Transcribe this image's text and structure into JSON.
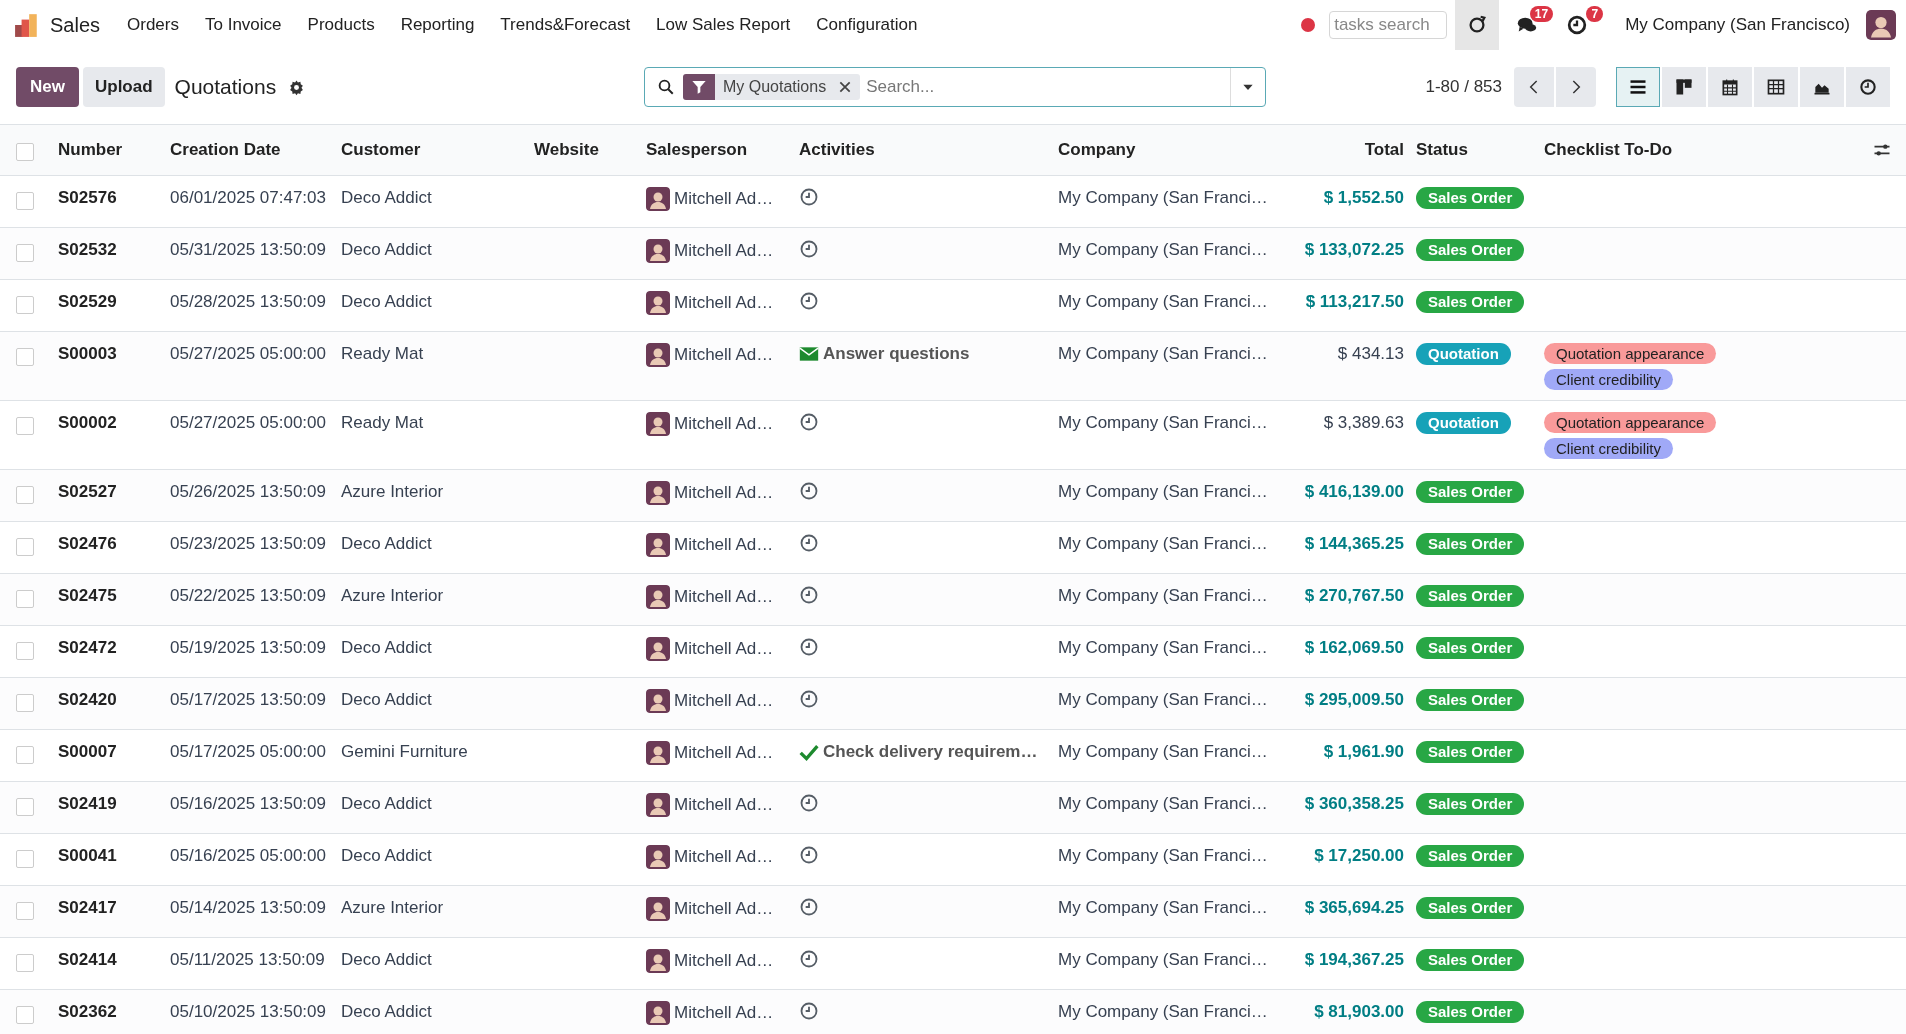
{
  "navbar": {
    "app_name": "Sales",
    "menu": [
      "Orders",
      "To Invoice",
      "Products",
      "Reporting",
      "Trends&Forecast",
      "Low Sales Report",
      "Configuration"
    ],
    "tasks_search": {
      "placeholder": "tasks search"
    },
    "messages_badge": "17",
    "activities_badge": "7",
    "company": "My Company (San Francisco)"
  },
  "control_panel": {
    "new_button": "New",
    "upload_button": "Upload",
    "title": "Quotations",
    "facet": "My Quotations",
    "search": {
      "placeholder": "Search..."
    },
    "pager": "1-80 / 853",
    "views": [
      {
        "kind": "list",
        "selected": true
      },
      {
        "kind": "kanban",
        "selected": false
      },
      {
        "kind": "calendar",
        "selected": false
      },
      {
        "kind": "pivot",
        "selected": false
      },
      {
        "kind": "graph",
        "selected": false
      },
      {
        "kind": "activity",
        "selected": false
      }
    ]
  },
  "table": {
    "select_all_checked": false,
    "columns": [
      "Number",
      "Creation Date",
      "Customer",
      "Website",
      "Salesperson",
      "Activities",
      "Company",
      "Total",
      "Status",
      "Checklist To-Do"
    ],
    "rows": [
      {
        "checked": false,
        "number": "S02576",
        "date": "06/01/2025 07:47:03",
        "customer": "Deco Addict",
        "salesperson": "Mitchell Ad…",
        "activity": {
          "kind": "none"
        },
        "company": "My Company (San Franci…",
        "total": "$ 1,552.50",
        "status": {
          "kind": "sales_order",
          "label": "Sales Order"
        },
        "tags": []
      },
      {
        "checked": false,
        "number": "S02532",
        "date": "05/31/2025 13:50:09",
        "customer": "Deco Addict",
        "salesperson": "Mitchell Ad…",
        "activity": {
          "kind": "none"
        },
        "company": "My Company (San Franci…",
        "total": "$ 133,072.25",
        "status": {
          "kind": "sales_order",
          "label": "Sales Order"
        },
        "tags": []
      },
      {
        "checked": false,
        "number": "S02529",
        "date": "05/28/2025 13:50:09",
        "customer": "Deco Addict",
        "salesperson": "Mitchell Ad…",
        "activity": {
          "kind": "none"
        },
        "company": "My Company (San Franci…",
        "total": "$ 113,217.50",
        "status": {
          "kind": "sales_order",
          "label": "Sales Order"
        },
        "tags": []
      },
      {
        "checked": false,
        "number": "S00003",
        "date": "05/27/2025 05:00:00",
        "customer": "Ready Mat",
        "salesperson": "Mitchell Ad…",
        "activity": {
          "kind": "email",
          "label": "Answer questions"
        },
        "company": "My Company (San Franci…",
        "total": "$ 434.13",
        "status": {
          "kind": "quotation",
          "label": "Quotation"
        },
        "tags": [
          {
            "label": "Quotation appearance",
            "color": "#f99a9a"
          },
          {
            "label": "Client credibility",
            "color": "#a0a9f7"
          }
        ]
      },
      {
        "checked": false,
        "number": "S00002",
        "date": "05/27/2025 05:00:00",
        "customer": "Ready Mat",
        "salesperson": "Mitchell Ad…",
        "activity": {
          "kind": "none"
        },
        "company": "My Company (San Franci…",
        "total": "$ 3,389.63",
        "status": {
          "kind": "quotation",
          "label": "Quotation"
        },
        "tags": [
          {
            "label": "Quotation appearance",
            "color": "#f99a9a"
          },
          {
            "label": "Client credibility",
            "color": "#a0a9f7"
          }
        ]
      },
      {
        "checked": false,
        "number": "S02527",
        "date": "05/26/2025 13:50:09",
        "customer": "Azure Interior",
        "salesperson": "Mitchell Ad…",
        "activity": {
          "kind": "none"
        },
        "company": "My Company (San Franci…",
        "total": "$ 416,139.00",
        "status": {
          "kind": "sales_order",
          "label": "Sales Order"
        },
        "tags": []
      },
      {
        "checked": false,
        "number": "S02476",
        "date": "05/23/2025 13:50:09",
        "customer": "Deco Addict",
        "salesperson": "Mitchell Ad…",
        "activity": {
          "kind": "none"
        },
        "company": "My Company (San Franci…",
        "total": "$ 144,365.25",
        "status": {
          "kind": "sales_order",
          "label": "Sales Order"
        },
        "tags": []
      },
      {
        "checked": false,
        "number": "S02475",
        "date": "05/22/2025 13:50:09",
        "customer": "Azure Interior",
        "salesperson": "Mitchell Ad…",
        "activity": {
          "kind": "none"
        },
        "company": "My Company (San Franci…",
        "total": "$ 270,767.50",
        "status": {
          "kind": "sales_order",
          "label": "Sales Order"
        },
        "tags": []
      },
      {
        "checked": false,
        "number": "S02472",
        "date": "05/19/2025 13:50:09",
        "customer": "Deco Addict",
        "salesperson": "Mitchell Ad…",
        "activity": {
          "kind": "none"
        },
        "company": "My Company (San Franci…",
        "total": "$ 162,069.50",
        "status": {
          "kind": "sales_order",
          "label": "Sales Order"
        },
        "tags": []
      },
      {
        "checked": false,
        "number": "S02420",
        "date": "05/17/2025 13:50:09",
        "customer": "Deco Addict",
        "salesperson": "Mitchell Ad…",
        "activity": {
          "kind": "none"
        },
        "company": "My Company (San Franci…",
        "total": "$ 295,009.50",
        "status": {
          "kind": "sales_order",
          "label": "Sales Order"
        },
        "tags": []
      },
      {
        "checked": false,
        "number": "S00007",
        "date": "05/17/2025 05:00:00",
        "customer": "Gemini Furniture",
        "salesperson": "Mitchell Ad…",
        "activity": {
          "kind": "done",
          "label": "Check delivery requirem…"
        },
        "company": "My Company (San Franci…",
        "total": "$ 1,961.90",
        "status": {
          "kind": "sales_order",
          "label": "Sales Order"
        },
        "tags": []
      },
      {
        "checked": false,
        "number": "S02419",
        "date": "05/16/2025 13:50:09",
        "customer": "Deco Addict",
        "salesperson": "Mitchell Ad…",
        "activity": {
          "kind": "none"
        },
        "company": "My Company (San Franci…",
        "total": "$ 360,358.25",
        "status": {
          "kind": "sales_order",
          "label": "Sales Order"
        },
        "tags": []
      },
      {
        "checked": false,
        "number": "S00041",
        "date": "05/16/2025 05:00:00",
        "customer": "Deco Addict",
        "salesperson": "Mitchell Ad…",
        "activity": {
          "kind": "none"
        },
        "company": "My Company (San Franci…",
        "total": "$ 17,250.00",
        "status": {
          "kind": "sales_order",
          "label": "Sales Order"
        },
        "tags": []
      },
      {
        "checked": false,
        "number": "S02417",
        "date": "05/14/2025 13:50:09",
        "customer": "Azure Interior",
        "salesperson": "Mitchell Ad…",
        "activity": {
          "kind": "none"
        },
        "company": "My Company (San Franci…",
        "total": "$ 365,694.25",
        "status": {
          "kind": "sales_order",
          "label": "Sales Order"
        },
        "tags": []
      },
      {
        "checked": false,
        "number": "S02414",
        "date": "05/11/2025 13:50:09",
        "customer": "Deco Addict",
        "salesperson": "Mitchell Ad…",
        "activity": {
          "kind": "none"
        },
        "company": "My Company (San Franci…",
        "total": "$ 194,367.25",
        "status": {
          "kind": "sales_order",
          "label": "Sales Order"
        },
        "tags": []
      },
      {
        "checked": false,
        "number": "S02362",
        "date": "05/10/2025 13:50:09",
        "customer": "Deco Addict",
        "salesperson": "Mitchell Ad…",
        "activity": {
          "kind": "none"
        },
        "company": "My Company (San Franci…",
        "total": "$ 81,903.00",
        "status": {
          "kind": "sales_order",
          "label": "Sales Order"
        },
        "tags": []
      }
    ]
  }
}
